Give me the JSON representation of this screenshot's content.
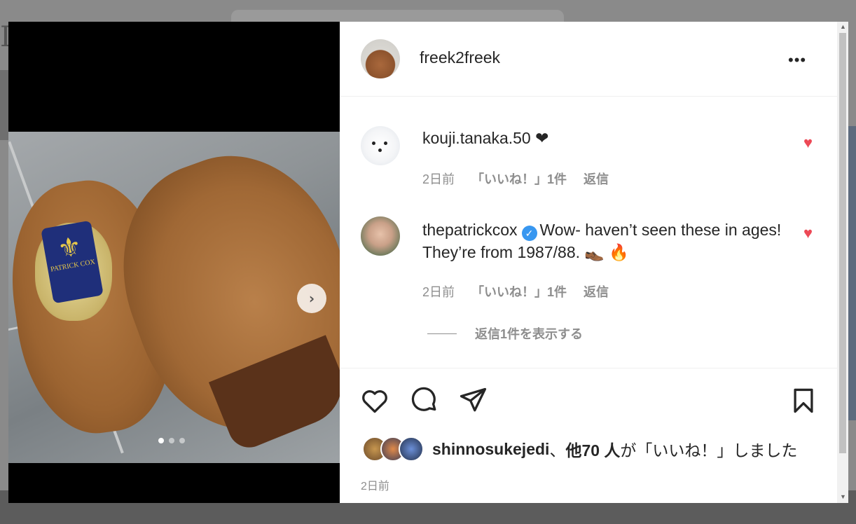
{
  "post": {
    "author": "freek2freek",
    "more_label": "•••",
    "carousel": {
      "total_slides": 3,
      "active_slide": 1,
      "next_label": "›",
      "photo_label_brand": "PATRICK COX"
    }
  },
  "comments": [
    {
      "username": "kouji.tanaka.50",
      "text": " ❤",
      "time": "2日前",
      "likes": "「いいね！」1件",
      "reply": "返信",
      "liked": true
    },
    {
      "username": "thepatrickcox",
      "verified": true,
      "text": "Wow- haven’t seen these in ages! They’re from 1987/88. 👞 🔥",
      "time": "2日前",
      "likes": "「いいね！」1件",
      "reply": "返信",
      "liked": true,
      "view_replies": "返信1件を表示する"
    }
  ],
  "actions": {
    "like_icon": "heart-outline-icon",
    "comment_icon": "comment-bubble-icon",
    "share_icon": "paper-plane-icon",
    "save_icon": "bookmark-icon"
  },
  "likes_summary": {
    "user": "shinnosukejedi",
    "sep": "、",
    "others": "他70 人",
    "suffix": "が「いいね！」しました"
  },
  "timestamp": "2日前",
  "colors": {
    "liked_heart": "#ed4956",
    "verified": "#3897f0",
    "meta_text": "#8e8e8e"
  }
}
